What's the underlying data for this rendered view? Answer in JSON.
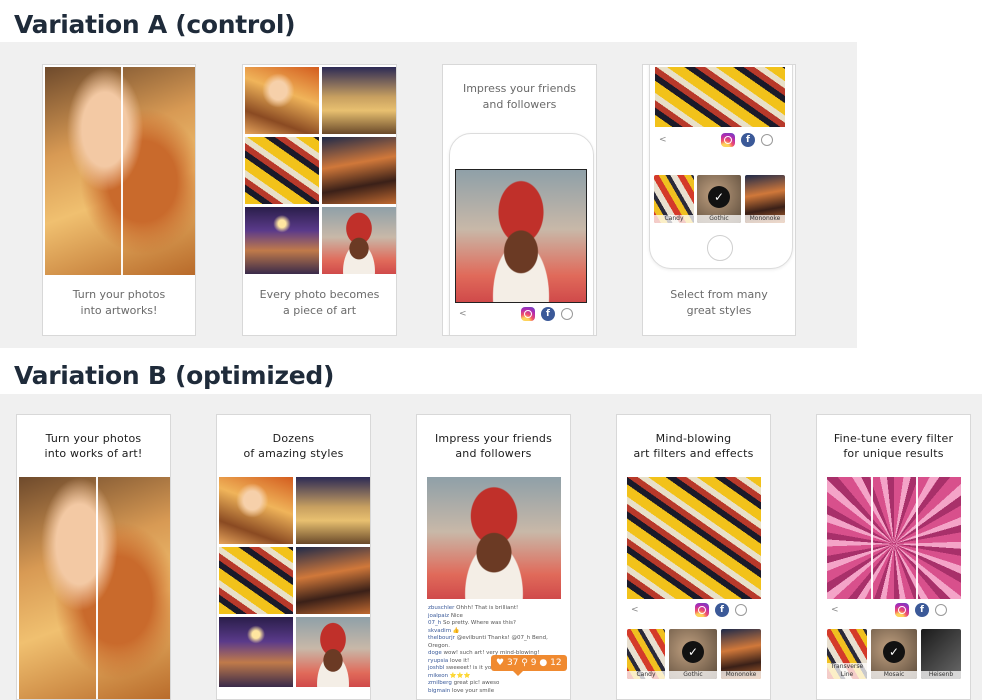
{
  "sections": {
    "a_title": "Variation A (control)",
    "b_title": "Variation B (optimized)"
  },
  "variation_a": {
    "cards": [
      {
        "caption": "Turn your photos\ninto artworks!"
      },
      {
        "caption": "Every photo becomes\na piece of art"
      },
      {
        "caption": "Impress your friends\nand followers"
      },
      {
        "caption": "Select from many\ngreat styles"
      }
    ],
    "style_thumbs": [
      "Candy",
      "Gothic",
      "Mononoke"
    ]
  },
  "variation_b": {
    "cards": [
      {
        "caption": "Turn your photos\ninto works of art!"
      },
      {
        "caption": "Dozens\nof amazing styles"
      },
      {
        "caption": "Impress your friends\nand followers"
      },
      {
        "caption": "Mind-blowing\nart filters and effects"
      },
      {
        "caption": "Fine-tune every filter\nfor unique results"
      }
    ],
    "comments": [
      {
        "user": "zbuschler",
        "text": "Ohhh! That is brilliant!"
      },
      {
        "user": "joalpaiz",
        "text": "Nice"
      },
      {
        "user": "07_h",
        "text": "So pretty. Where was this?"
      },
      {
        "user": "skvadim",
        "text": "👍"
      },
      {
        "user": "thelbourjr",
        "text": "@evilbunti Thanks! @07_h Bend, Oregon."
      },
      {
        "user": "doge",
        "text": "wow! such art! very mind-blowing!"
      },
      {
        "user": "ryupsia",
        "text": "love it!"
      },
      {
        "user": "joshbl",
        "text": "sweeeet! is it your"
      },
      {
        "user": "mikeon",
        "text": "⭐⭐⭐"
      },
      {
        "user": "zmilberg",
        "text": "great pic! aweso"
      },
      {
        "user": "bigmain",
        "text": "love your smile"
      }
    ],
    "like_counts": {
      "likes": "37",
      "followers": "9",
      "comments": "12"
    },
    "style_thumbs_c4": [
      "Candy",
      "Gothic",
      "Mononoke"
    ],
    "style_thumbs_c5": [
      "Transverse Line",
      "Mosaic",
      "Heisenb"
    ]
  },
  "icons": {
    "facebook_glyph": "f",
    "back_glyph": "<",
    "check_glyph": "✓"
  }
}
